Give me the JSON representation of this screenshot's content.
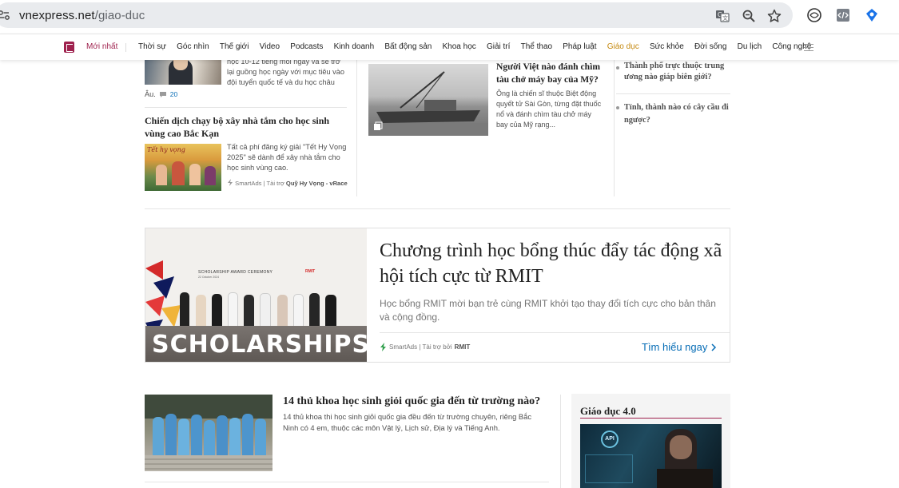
{
  "browser": {
    "url_host": "vnexpress.net",
    "url_path": "/giao-duc",
    "icons": [
      "site-info-icon",
      "translate-icon",
      "zoom-icon",
      "bookmark-star-icon",
      "extension-icon",
      "code-extension-icon",
      "tag-extension-icon"
    ]
  },
  "nav": {
    "newest": "Mới nhất",
    "items": [
      "Thời sự",
      "Góc nhìn",
      "Thế giới",
      "Video",
      "Podcasts",
      "Kinh doanh",
      "Bất động sản",
      "Khoa học",
      "Giải trí",
      "Thể thao",
      "Pháp luật",
      "Giáo dục",
      "Sức khỏe",
      "Đời sống",
      "Du lịch",
      "Công nghệ"
    ],
    "active": "Giáo dục",
    "accent_color": "#9f224e",
    "active_color": "#c5890f"
  },
  "left_col": {
    "top_snippet_lines": [
      "học 10-12 tiếng mỗi ngày và se trở",
      "lại guồng học ngày với mục tiêu vào",
      "đội tuyển quốc tế và du học châu"
    ],
    "top_snippet_tail": "Âu.",
    "comment_count": "20",
    "article2": {
      "title": "Chiến dịch chạy bộ xây nhà tắm cho học sinh vùng cao Bắc Kạn",
      "desc": "Tất cả phí đăng ký giải \"Tết Hy Vọng 2025\" sẽ dành để xây nhà tắm cho học sinh vùng cao.",
      "sponsor_prefix": "SmartAds | Tài trợ",
      "sponsor_name": "Quỹ Hy Vọng - vRace",
      "thumb_text": "Tết hy vọng"
    }
  },
  "mid_col": {
    "title": "Người Việt nào đánh chìm tàu chở máy bay của Mỹ?",
    "desc": "Ông là chiến sĩ thuộc Biệt động quyết tử Sài Gòn, từng đặt thuốc nổ và đánh chìm tàu chở máy bay của Mỹ rạng..."
  },
  "right_col": {
    "items": [
      "Thành phố trực thuộc trung ương nào giáp biên giới?",
      "Tỉnh, thành nào có cây cầu đi ngược?"
    ]
  },
  "ad": {
    "title": "Chương trình học bổng thúc đẩy tác động xã hội tích cực từ RMIT",
    "desc": "Học bổng RMIT mời bạn trẻ cùng RMIT khởi tạo thay đổi tích cực cho bản thân và cộng đồng.",
    "sponsor_prefix": "SmartAds | Tài trợ bởi",
    "sponsor_name": "RMIT",
    "cta": "Tìm hiểu ngay",
    "image_banner": "SCHOLARSHIPS",
    "image_heading": "SCHOLARSHIP AWARD CEREMONY",
    "image_date": "22 October 2024",
    "image_logo": "RMIT"
  },
  "article_bottom": {
    "title": "14 thủ khoa học sinh giỏi quốc gia đến từ trường nào?",
    "desc": "14 thủ khoa thi học sinh giỏi quốc gia đều đến từ trường chuyên, riêng Bắc Ninh có 4 em, thuộc các môn Vật lý, Lịch sử, Địa lý và Tiếng Anh."
  },
  "side_box": {
    "title": "Giáo dục 4.0",
    "thumb_badge": "API"
  }
}
